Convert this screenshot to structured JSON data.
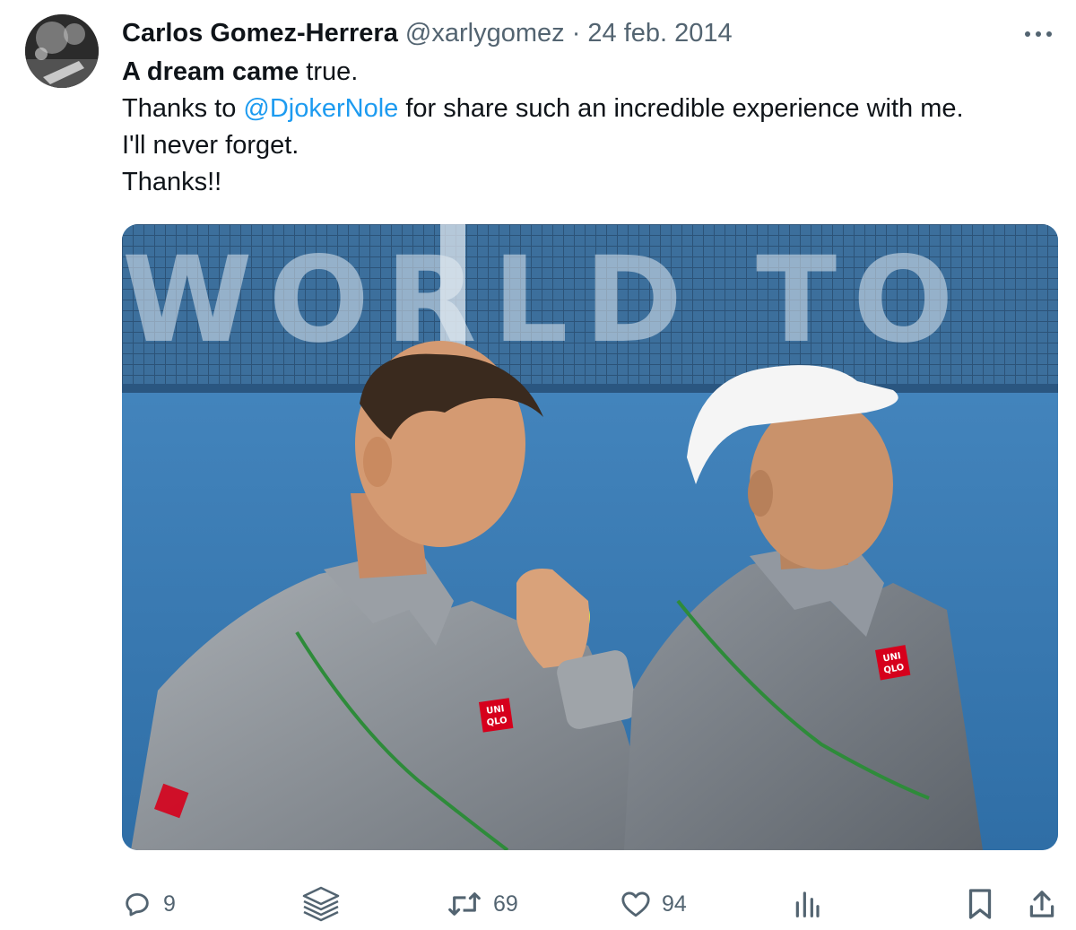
{
  "author": {
    "name": "Carlos Gomez-Herrera",
    "handle": "@xarlygomez",
    "separator": "·",
    "date": "24 feb. 2014"
  },
  "tweet": {
    "line1_bold": "A dream came",
    "line1_rest": " true.",
    "line2_before": "Thanks to ",
    "line2_mention": "@DjokerNole",
    "line2_after": " for share such an incredible experience with me.",
    "line3": "I'll never forget.",
    "line4": "Thanks!!"
  },
  "photo": {
    "background_sign_text": "WORLD TO",
    "shirt_logo_line1": "UNI",
    "shirt_logo_line2": "QLO"
  },
  "actions": {
    "replies_count": "9",
    "reposts_count": "69",
    "likes_count": "94"
  },
  "icons": {
    "more": "more-horizontal-icon",
    "reply": "reply-icon",
    "layers": "stack-icon",
    "repost": "repost-icon",
    "like": "heart-icon",
    "views": "bar-chart-icon",
    "bookmark": "bookmark-icon",
    "share": "share-icon"
  },
  "colors": {
    "text": "#0f1419",
    "secondary": "#536471",
    "mention": "#1d9bf0",
    "court": "#3f7fb4",
    "uniqlo_red": "#d6001c"
  }
}
